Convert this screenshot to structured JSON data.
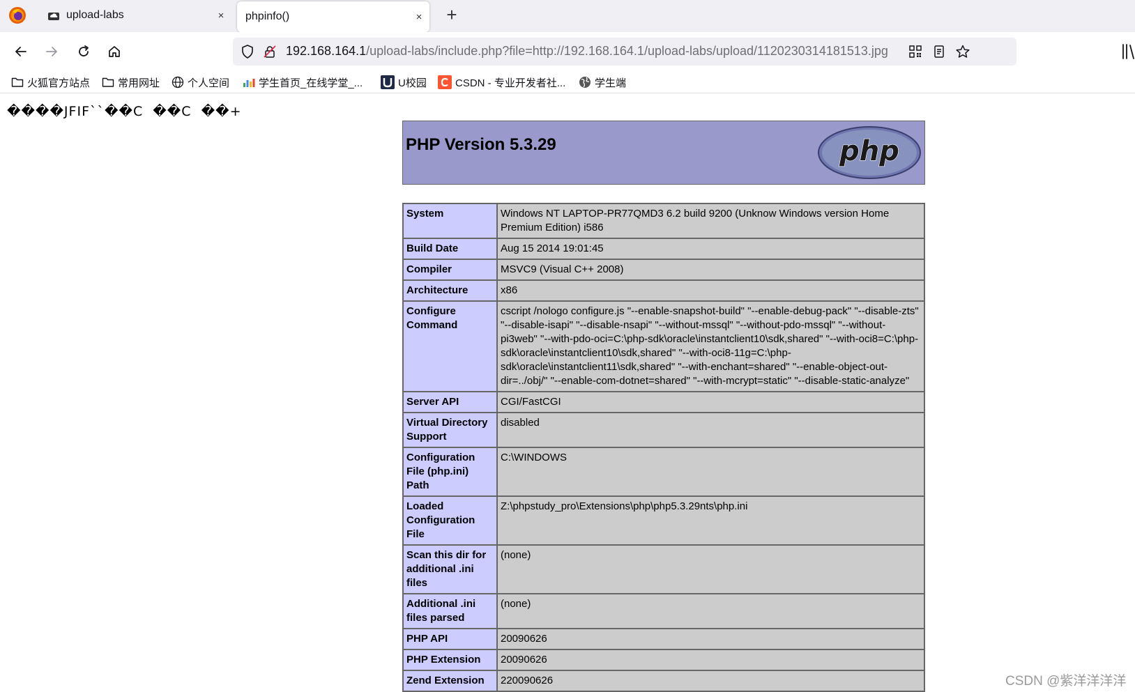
{
  "tabs": [
    {
      "title": "upload-labs",
      "close": "×"
    },
    {
      "title": "phpinfo()",
      "close": "×"
    }
  ],
  "new_tab": "+",
  "address_bar": {
    "host": "192.168.164.1",
    "path": "/upload-labs/include.php?file=http://192.168.164.1/upload-labs/upload/1120230314181513.jpg"
  },
  "bookmarks": [
    {
      "label": "火狐官方站点",
      "icon": "folder-icon"
    },
    {
      "label": "常用网址",
      "icon": "folder-icon"
    },
    {
      "label": "个人空间",
      "icon": "globe-icon"
    },
    {
      "label": "学生首页_在线学堂_...",
      "icon": "chart-icon"
    },
    {
      "label": "U校园",
      "icon": "u-logo"
    },
    {
      "label": "CSDN - 专业开发者社...",
      "icon": "csdn-logo"
    },
    {
      "label": "学生端",
      "icon": "globe-icon"
    }
  ],
  "page": {
    "garbage_text": "����JFIF``��C  ��C  ��+",
    "php_version": "PHP Version 5.3.29",
    "php_logo_text": "php",
    "rows": [
      {
        "key": "System",
        "value": "Windows NT LAPTOP-PR77QMD3 6.2 build 9200 (Unknow Windows version Home Premium Edition) i586"
      },
      {
        "key": "Build Date",
        "value": "Aug 15 2014 19:01:45"
      },
      {
        "key": "Compiler",
        "value": "MSVC9 (Visual C++ 2008)"
      },
      {
        "key": "Architecture",
        "value": "x86"
      },
      {
        "key": "Configure Command",
        "value": "cscript /nologo configure.js \"--enable-snapshot-build\" \"--enable-debug-pack\" \"--disable-zts\" \"--disable-isapi\" \"--disable-nsapi\" \"--without-mssql\" \"--without-pdo-mssql\" \"--without-pi3web\" \"--with-pdo-oci=C:\\php-sdk\\oracle\\instantclient10\\sdk,shared\" \"--with-oci8=C:\\php-sdk\\oracle\\instantclient10\\sdk,shared\" \"--with-oci8-11g=C:\\php-sdk\\oracle\\instantclient11\\sdk,shared\" \"--with-enchant=shared\" \"--enable-object-out-dir=../obj/\" \"--enable-com-dotnet=shared\" \"--with-mcrypt=static\" \"--disable-static-analyze\""
      },
      {
        "key": "Server API",
        "value": "CGI/FastCGI"
      },
      {
        "key": "Virtual Directory Support",
        "value": "disabled"
      },
      {
        "key": "Configuration File (php.ini) Path",
        "value": "C:\\WINDOWS"
      },
      {
        "key": "Loaded Configuration File",
        "value": "Z:\\phpstudy_pro\\Extensions\\php\\php5.3.29nts\\php.ini"
      },
      {
        "key": "Scan this dir for additional .ini files",
        "value": "(none)"
      },
      {
        "key": "Additional .ini files parsed",
        "value": "(none)"
      },
      {
        "key": "PHP API",
        "value": "20090626"
      },
      {
        "key": "PHP Extension",
        "value": "20090626"
      },
      {
        "key": "Zend Extension",
        "value": "220090626"
      }
    ]
  },
  "watermark": "CSDN @紫洋洋洋洋"
}
